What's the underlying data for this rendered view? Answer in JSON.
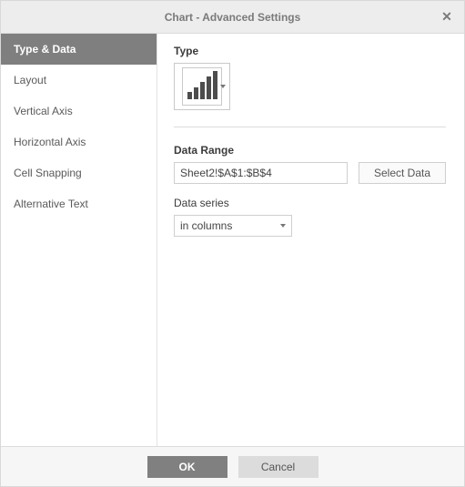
{
  "dialog": {
    "title": "Chart - Advanced Settings"
  },
  "sidebar": {
    "items": [
      {
        "label": "Type & Data",
        "active": true
      },
      {
        "label": "Layout",
        "active": false
      },
      {
        "label": "Vertical Axis",
        "active": false
      },
      {
        "label": "Horizontal Axis",
        "active": false
      },
      {
        "label": "Cell Snapping",
        "active": false
      },
      {
        "label": "Alternative Text",
        "active": false
      }
    ]
  },
  "content": {
    "type_label": "Type",
    "chart_type": "column-chart",
    "data_range_label": "Data Range",
    "data_range_value": "Sheet2!$A$1:$B$4",
    "select_data_label": "Select Data",
    "data_series_label": "Data series",
    "data_series_value": "in columns"
  },
  "footer": {
    "ok_label": "OK",
    "cancel_label": "Cancel"
  }
}
